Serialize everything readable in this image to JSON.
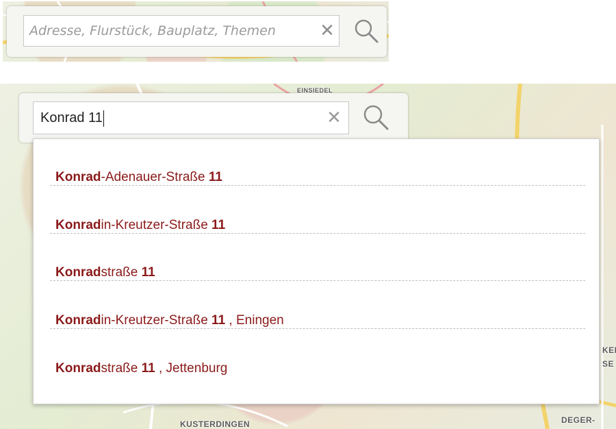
{
  "top_search": {
    "placeholder": "Adresse, Flurstück, Bauplatz, Themen",
    "clear_symbol": "✕",
    "search_icon": "magnifier-icon"
  },
  "bottom_search": {
    "value": "Konrad 11",
    "clear_symbol": "✕",
    "search_icon": "magnifier-icon"
  },
  "map_labels": {
    "einsiedel": "EINSIEDEL",
    "kusterdingen": "KUSTERDINGEN",
    "deger": "DEGER-",
    "right_fragment_1": "KEN",
    "right_fragment_2": "SE"
  },
  "suggestions": [
    {
      "match": "Konrad",
      "rest": "-Adenauer-Straße ",
      "number": "11",
      "suffix": ""
    },
    {
      "match": "Konrad",
      "rest": "in-Kreutzer-Straße ",
      "number": "11",
      "suffix": ""
    },
    {
      "match": "Konrad",
      "rest": "straße ",
      "number": "11",
      "suffix": ""
    },
    {
      "match": "Konrad",
      "rest": "in-Kreutzer-Straße ",
      "number": "11",
      "suffix": " , Eningen"
    },
    {
      "match": "Konrad",
      "rest": "straße ",
      "number": "11",
      "suffix": " , Jettenburg"
    }
  ],
  "colors": {
    "suggestion_text": "#8b1a1a",
    "widget_bg": "#f5f5f2",
    "border": "#c8c8c8"
  }
}
